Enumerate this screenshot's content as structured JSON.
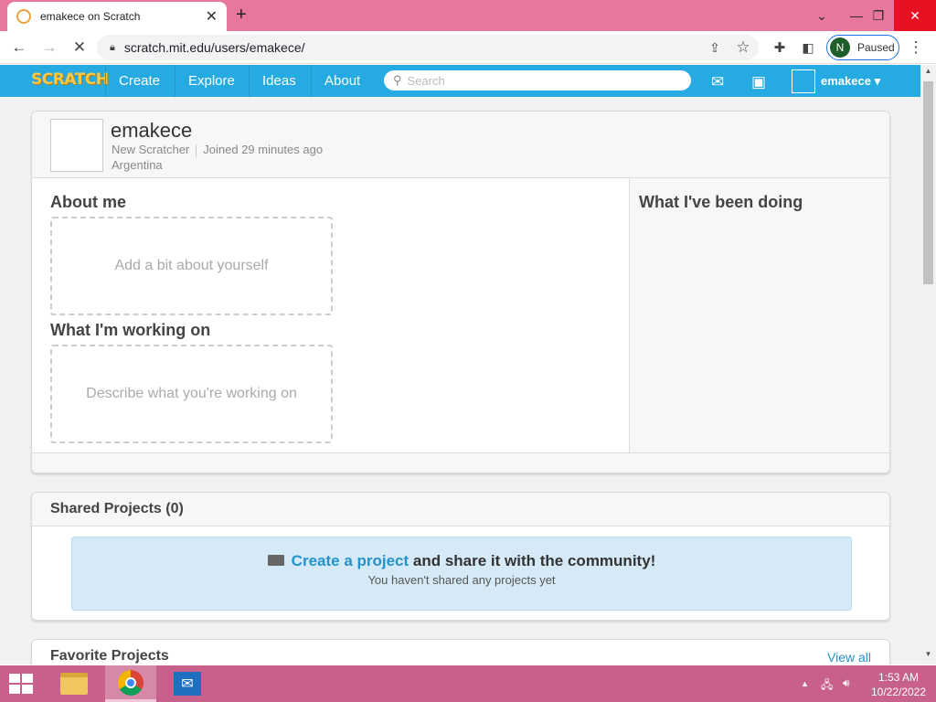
{
  "browser": {
    "tab_title": "emakece on Scratch",
    "url": "scratch.mit.edu/users/emakece/",
    "profile_initial": "N",
    "profile_status": "Paused"
  },
  "nav": {
    "logo": "SCRATCH",
    "links": [
      "Create",
      "Explore",
      "Ideas",
      "About"
    ],
    "search_placeholder": "Search",
    "username": "emakece"
  },
  "profile": {
    "username": "emakece",
    "rank": "New Scratcher",
    "joined": "Joined 29 minutes ago",
    "location": "Argentina",
    "about_heading": "About me",
    "about_placeholder": "Add a bit about yourself",
    "working_heading": "What I'm working on",
    "working_placeholder": "Describe what you're working on",
    "activity_heading": "What I've been doing"
  },
  "shared": {
    "title": "Shared Projects (0)",
    "create_link": "Create a project",
    "create_rest": " and share it with the community!",
    "empty_note": "You haven't shared any projects yet"
  },
  "favorites": {
    "title": "Favorite Projects",
    "view_all": "View all"
  },
  "taskbar": {
    "time": "1:53 AM",
    "date": "10/22/2022"
  },
  "colors": {
    "scratch_blue": "#25aae1",
    "link_blue": "#2592cc",
    "tabstrip": "#e8779f",
    "taskbar": "#c7618b"
  }
}
